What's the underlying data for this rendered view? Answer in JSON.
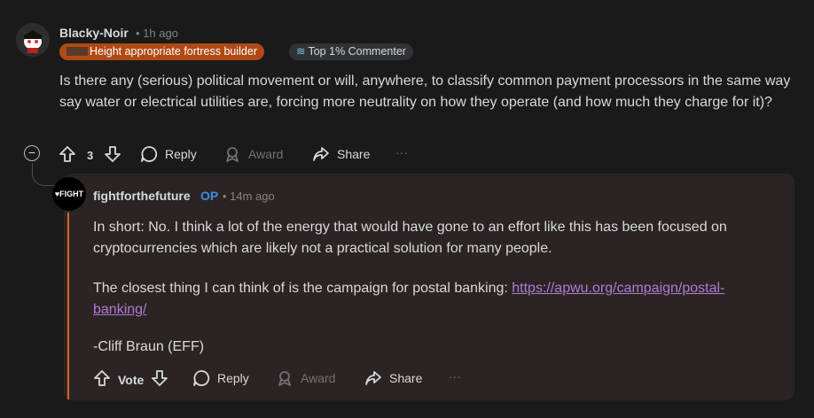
{
  "comment": {
    "author": "Blacky-Noir",
    "meta": "• 1h ago",
    "flairs": [
      {
        "label": "Height appropriate fortress builder",
        "icon": "flag-icon"
      },
      {
        "label": "Top 1% Commenter",
        "icon": "commenter-badge-icon"
      }
    ],
    "body": "Is there any (serious) political movement or will, anywhere, to classify common payment processors in the same way say water or electrical utilities are, forcing more neutrality on how they operate (and how much they charge for it)?",
    "votes": "3",
    "actions": {
      "reply": "Reply",
      "award": "Award",
      "share": "Share",
      "more": "···"
    }
  },
  "reply": {
    "author": "fightforthefuture",
    "op_badge": "OP",
    "meta": "• 14m ago",
    "avatar_text": "FIGHT",
    "paragraphs": [
      "In short: No. I think a lot of the energy that would have gone to an effort like this has been focused on cryptocurrencies which are likely not a practical solution for many people.",
      "The closest thing I can think of is the campaign for postal banking: "
    ],
    "link": "https://apwu.org/campaign/postal-banking/",
    "signature": "-Cliff Braun (EFF)",
    "actions": {
      "vote": "Vote",
      "reply": "Reply",
      "award": "Award",
      "share": "Share",
      "more": "···"
    }
  },
  "colors": {
    "background": "#1a1a1b",
    "reply_card": "#2c2423",
    "op_accent": "#d9622b",
    "op_badge": "#3d8ce8",
    "link": "#b17ad6",
    "flair_orange": "#b04a14"
  }
}
